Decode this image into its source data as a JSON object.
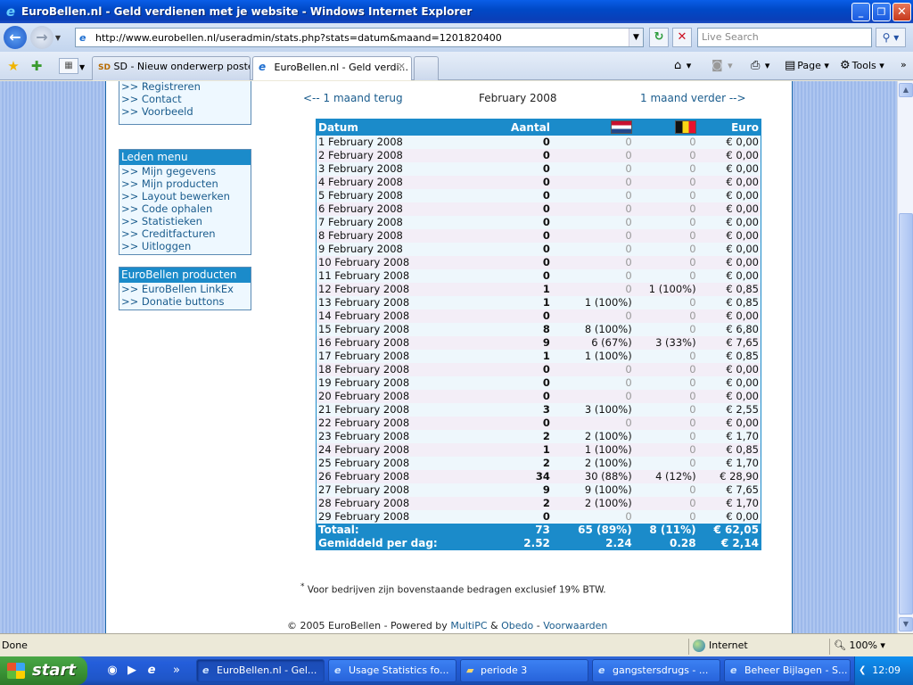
{
  "window": {
    "title": "EuroBellen.nl - Geld verdienen met je website - Windows Internet Explorer"
  },
  "address_bar": {
    "url": "http://www.eurobellen.nl/useradmin/stats.php?stats=datum&maand=1201820400",
    "search_placeholder": "Live Search"
  },
  "tabs": [
    {
      "label": "SD - Nieuw onderwerp posten",
      "favicon": "SD"
    },
    {
      "label": "EuroBellen.nl - Geld verdi...",
      "favicon": "ie-icon"
    }
  ],
  "commands": {
    "page": "Page",
    "tools": "Tools"
  },
  "sidebar": {
    "top_links": [
      ">> Registreren",
      ">> Contact",
      ">> Voorbeeld"
    ],
    "leden_menu": {
      "title": "Leden menu",
      "links": [
        ">> Mijn gegevens",
        ">> Mijn producten",
        ">> Layout bewerken",
        ">> Code ophalen",
        ">> Statistieken",
        ">> Creditfacturen",
        ">> Uitloggen"
      ]
    },
    "producten": {
      "title": "EuroBellen producten",
      "links": [
        ">> EuroBellen LinkEx",
        ">> Donatie buttons"
      ]
    }
  },
  "month_nav": {
    "prev": "<-- 1 maand terug",
    "current": "February 2008",
    "next": "1 maand verder -->"
  },
  "stats_table": {
    "headers": {
      "datum": "Datum",
      "aantal": "Aantal",
      "nl": "flag-nl-icon",
      "be": "flag-be-icon",
      "euro": "Euro"
    },
    "rows": [
      {
        "date": "1 February 2008",
        "aantal": "0",
        "nl": "0",
        "be": "0",
        "euro": "€ 0,00"
      },
      {
        "date": "2 February 2008",
        "aantal": "0",
        "nl": "0",
        "be": "0",
        "euro": "€ 0,00"
      },
      {
        "date": "3 February 2008",
        "aantal": "0",
        "nl": "0",
        "be": "0",
        "euro": "€ 0,00"
      },
      {
        "date": "4 February 2008",
        "aantal": "0",
        "nl": "0",
        "be": "0",
        "euro": "€ 0,00"
      },
      {
        "date": "5 February 2008",
        "aantal": "0",
        "nl": "0",
        "be": "0",
        "euro": "€ 0,00"
      },
      {
        "date": "6 February 2008",
        "aantal": "0",
        "nl": "0",
        "be": "0",
        "euro": "€ 0,00"
      },
      {
        "date": "7 February 2008",
        "aantal": "0",
        "nl": "0",
        "be": "0",
        "euro": "€ 0,00"
      },
      {
        "date": "8 February 2008",
        "aantal": "0",
        "nl": "0",
        "be": "0",
        "euro": "€ 0,00"
      },
      {
        "date": "9 February 2008",
        "aantal": "0",
        "nl": "0",
        "be": "0",
        "euro": "€ 0,00"
      },
      {
        "date": "10 February 2008",
        "aantal": "0",
        "nl": "0",
        "be": "0",
        "euro": "€ 0,00"
      },
      {
        "date": "11 February 2008",
        "aantal": "0",
        "nl": "0",
        "be": "0",
        "euro": "€ 0,00"
      },
      {
        "date": "12 February 2008",
        "aantal": "1",
        "nl": "0",
        "be": "1 (100%)",
        "euro": "€ 0,85"
      },
      {
        "date": "13 February 2008",
        "aantal": "1",
        "nl": "1 (100%)",
        "be": "0",
        "euro": "€ 0,85"
      },
      {
        "date": "14 February 2008",
        "aantal": "0",
        "nl": "0",
        "be": "0",
        "euro": "€ 0,00"
      },
      {
        "date": "15 February 2008",
        "aantal": "8",
        "nl": "8 (100%)",
        "be": "0",
        "euro": "€ 6,80"
      },
      {
        "date": "16 February 2008",
        "aantal": "9",
        "nl": "6 (67%)",
        "be": "3 (33%)",
        "euro": "€ 7,65"
      },
      {
        "date": "17 February 2008",
        "aantal": "1",
        "nl": "1 (100%)",
        "be": "0",
        "euro": "€ 0,85"
      },
      {
        "date": "18 February 2008",
        "aantal": "0",
        "nl": "0",
        "be": "0",
        "euro": "€ 0,00"
      },
      {
        "date": "19 February 2008",
        "aantal": "0",
        "nl": "0",
        "be": "0",
        "euro": "€ 0,00"
      },
      {
        "date": "20 February 2008",
        "aantal": "0",
        "nl": "0",
        "be": "0",
        "euro": "€ 0,00"
      },
      {
        "date": "21 February 2008",
        "aantal": "3",
        "nl": "3 (100%)",
        "be": "0",
        "euro": "€ 2,55"
      },
      {
        "date": "22 February 2008",
        "aantal": "0",
        "nl": "0",
        "be": "0",
        "euro": "€ 0,00"
      },
      {
        "date": "23 February 2008",
        "aantal": "2",
        "nl": "2 (100%)",
        "be": "0",
        "euro": "€ 1,70"
      },
      {
        "date": "24 February 2008",
        "aantal": "1",
        "nl": "1 (100%)",
        "be": "0",
        "euro": "€ 0,85"
      },
      {
        "date": "25 February 2008",
        "aantal": "2",
        "nl": "2 (100%)",
        "be": "0",
        "euro": "€ 1,70"
      },
      {
        "date": "26 February 2008",
        "aantal": "34",
        "nl": "30 (88%)",
        "be": "4 (12%)",
        "euro": "€ 28,90"
      },
      {
        "date": "27 February 2008",
        "aantal": "9",
        "nl": "9 (100%)",
        "be": "0",
        "euro": "€ 7,65"
      },
      {
        "date": "28 February 2008",
        "aantal": "2",
        "nl": "2 (100%)",
        "be": "0",
        "euro": "€ 1,70"
      },
      {
        "date": "29 February 2008",
        "aantal": "0",
        "nl": "0",
        "be": "0",
        "euro": "€ 0,00"
      }
    ],
    "totaal": {
      "label": "Totaal:",
      "aantal": "73",
      "nl": "65 (89%)",
      "be": "8 (11%)",
      "euro": "€ 62,05"
    },
    "gemiddeld": {
      "label": "Gemiddeld per dag:",
      "aantal": "2.52",
      "nl": "2.24",
      "be": "0.28",
      "euro": "€ 2,14"
    }
  },
  "footnote": {
    "mark": "*",
    "text": "Voor bedrijven zijn bovenstaande bedragen exclusief 19% BTW."
  },
  "footer": {
    "prefix": "© 2005 EuroBellen - Powered by",
    "multipc": "MultiPC",
    "amp": "&",
    "obedo": "Obedo",
    "dash": "-",
    "voorwaarden": "Voorwaarden"
  },
  "statusbar": {
    "status": "Done",
    "zone": "Internet",
    "zoom": "100%"
  },
  "taskbar": {
    "start": "start",
    "tasks": [
      "EuroBellen.nl - Gel...",
      "Usage Statistics fo...",
      "periode 3",
      "gangstersdrugs - ...",
      "Beheer Bijlagen - S..."
    ],
    "clock": "12:09"
  },
  "colors": {
    "accent": "#1b8bca",
    "link": "#1a5c8d"
  }
}
